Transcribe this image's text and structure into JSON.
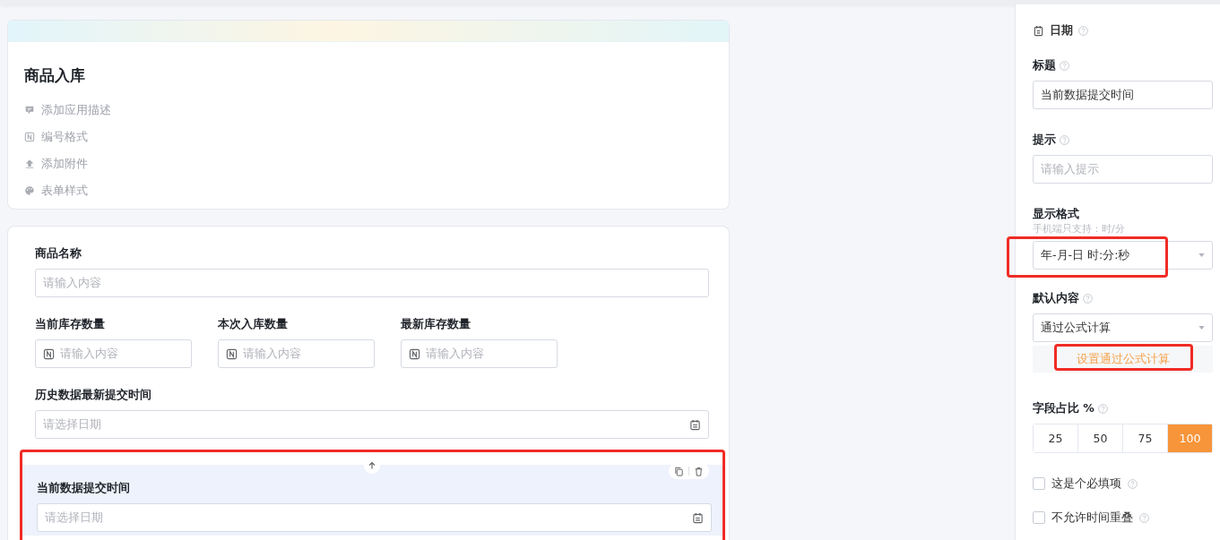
{
  "app_card": {
    "title": "商品入库",
    "actions": [
      {
        "kind": "comment",
        "label": "添加应用描述"
      },
      {
        "kind": "numbering",
        "label": "编号格式"
      },
      {
        "kind": "upload",
        "label": "添加附件"
      },
      {
        "kind": "palette",
        "label": "表单样式"
      }
    ]
  },
  "form": {
    "rows": [
      {
        "selected": false,
        "highlighted": false,
        "fields": [
          {
            "kind": "text",
            "label": "商品名称",
            "placeholder": "请输入内容"
          }
        ]
      },
      {
        "selected": false,
        "highlighted": false,
        "fields": [
          {
            "kind": "number",
            "label": "当前库存数量",
            "placeholder": "请输入内容"
          },
          {
            "kind": "number",
            "label": "本次入库数量",
            "placeholder": "请输入内容"
          },
          {
            "kind": "number",
            "label": "最新库存数量",
            "placeholder": "请输入内容"
          }
        ]
      },
      {
        "selected": false,
        "highlighted": false,
        "fields": [
          {
            "kind": "date",
            "label": "历史数据最新提交时间",
            "placeholder": "请选择日期"
          }
        ]
      },
      {
        "selected": true,
        "highlighted": true,
        "fields": [
          {
            "kind": "date",
            "label": "当前数据提交时间",
            "placeholder": "请选择日期"
          }
        ]
      }
    ]
  },
  "properties": {
    "title": "日期",
    "title_field": {
      "label": "标题",
      "value": "当前数据提交时间"
    },
    "hint_field": {
      "label": "提示",
      "placeholder": "请输入提示"
    },
    "display_format": {
      "label": "显示格式",
      "note": "手机端只支持：时/分",
      "value": "年-月-日 时:分:秒",
      "highlighted": true
    },
    "default_content": {
      "label": "默认内容",
      "value": "通过公式计算"
    },
    "formula_button": {
      "label": "设置通过公式计算",
      "highlighted": true
    },
    "width_ratio": {
      "label": "字段占比 %",
      "options": [
        {
          "label": "25",
          "selected": false
        },
        {
          "label": "50",
          "selected": false
        },
        {
          "label": "75",
          "selected": false
        },
        {
          "label": "100",
          "selected": true
        }
      ]
    },
    "checkboxes": [
      {
        "label": "这是个必填项",
        "checked": false
      },
      {
        "label": "不允许时间重叠",
        "checked": false
      }
    ]
  }
}
